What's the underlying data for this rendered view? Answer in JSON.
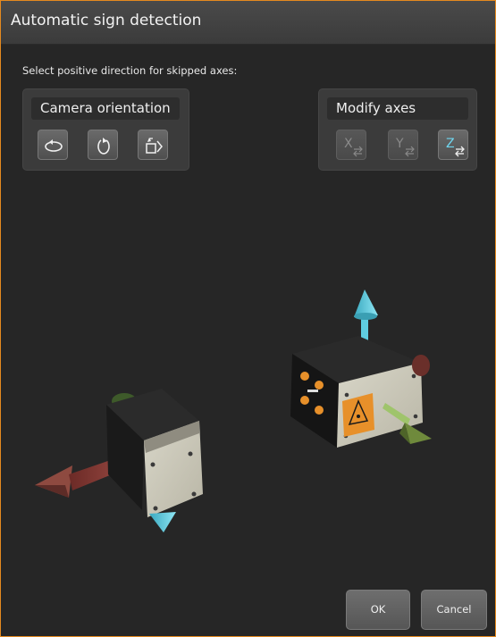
{
  "dialog": {
    "title": "Automatic sign detection",
    "instruction": "Select positive direction for skipped axes:"
  },
  "camera_panel": {
    "label": "Camera orientation",
    "buttons": [
      {
        "name": "rotate-horizontal-icon"
      },
      {
        "name": "rotate-vertical-icon"
      },
      {
        "name": "flip-view-icon"
      }
    ]
  },
  "axes_panel": {
    "label": "Modify axes",
    "buttons": [
      {
        "axis": "X",
        "enabled": false
      },
      {
        "axis": "Y",
        "enabled": false
      },
      {
        "axis": "Z",
        "enabled": true
      }
    ]
  },
  "actions": {
    "ok_label": "OK",
    "cancel_label": "Cancel"
  },
  "colors": {
    "accent_border": "#e58a1f",
    "z_axis": "#5fd0e0",
    "x_axis": "#8a3a34",
    "y_axis": "#6f8a3c",
    "laser_warning": "#e7902a"
  }
}
